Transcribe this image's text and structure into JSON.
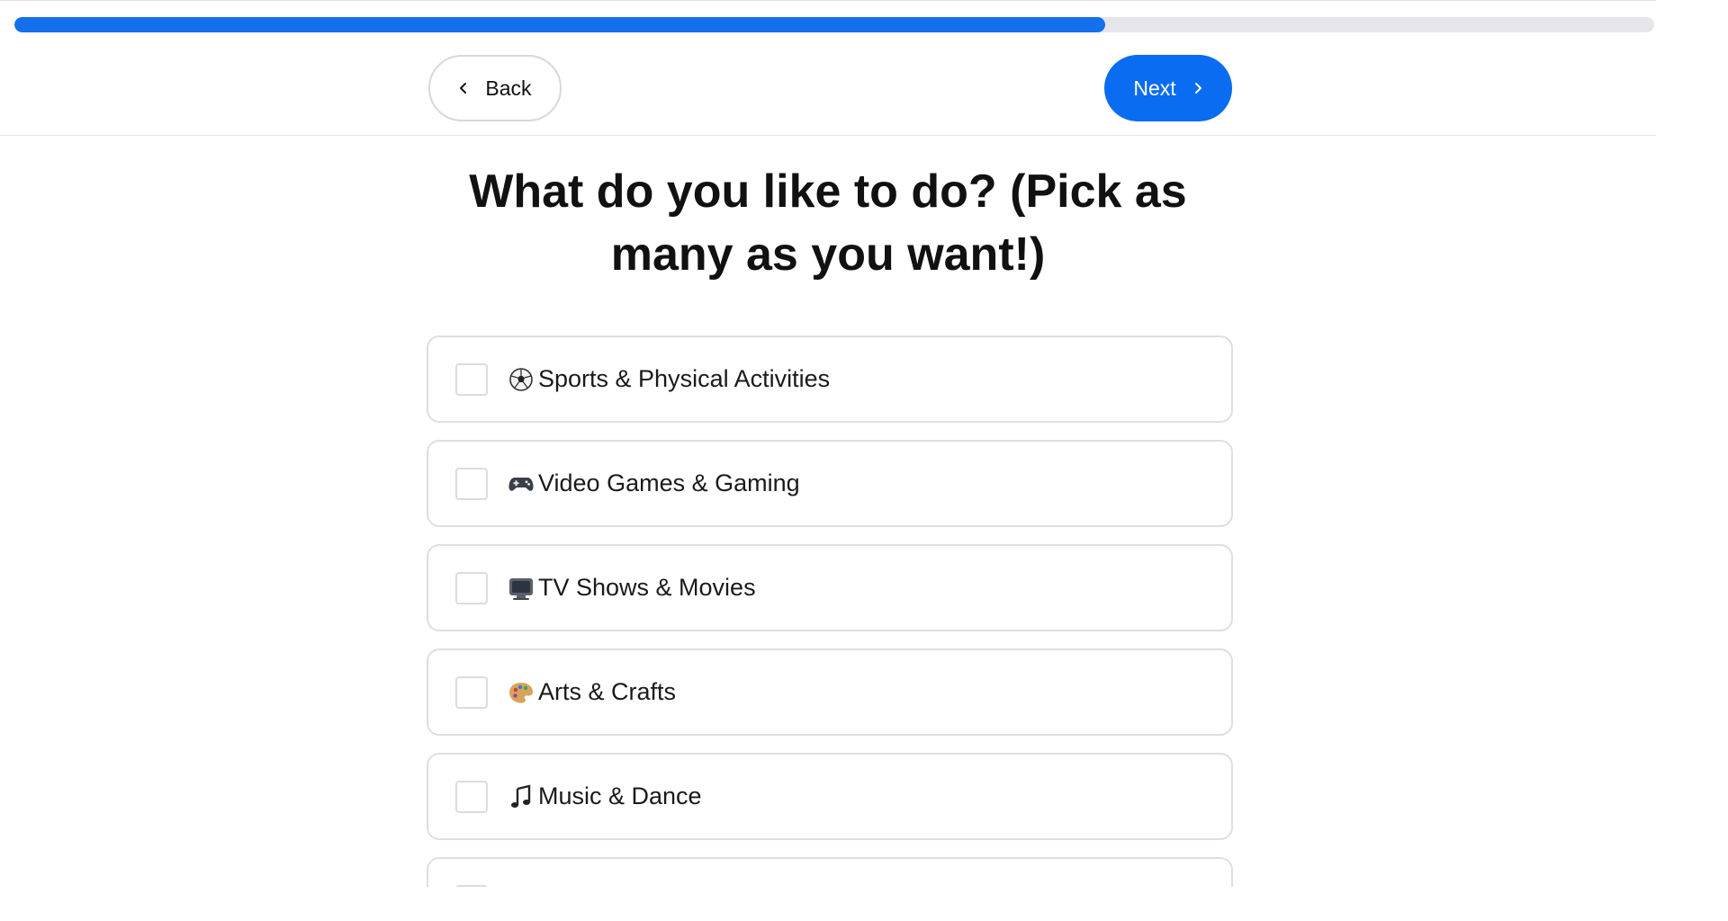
{
  "progress": {
    "percent": 66.5,
    "fill_color": "#1570ec"
  },
  "nav": {
    "back_label": "Back",
    "back_icon": "chevron-left-icon",
    "next_label": "Next",
    "next_icon": "chevron-right-icon",
    "next_color": "#0a6cf0"
  },
  "question": {
    "title": "What do you like to do? (Pick as many as you want!)"
  },
  "options": [
    {
      "icon": "soccer-ball-icon",
      "label": "Sports & Physical Activities",
      "checked": false
    },
    {
      "icon": "game-controller-icon",
      "label": "Video Games & Gaming",
      "checked": false
    },
    {
      "icon": "television-icon",
      "label": "TV Shows & Movies",
      "checked": false
    },
    {
      "icon": "palette-icon",
      "label": "Arts & Crafts",
      "checked": false
    },
    {
      "icon": "music-note-icon",
      "label": "Music & Dance",
      "checked": false
    }
  ]
}
